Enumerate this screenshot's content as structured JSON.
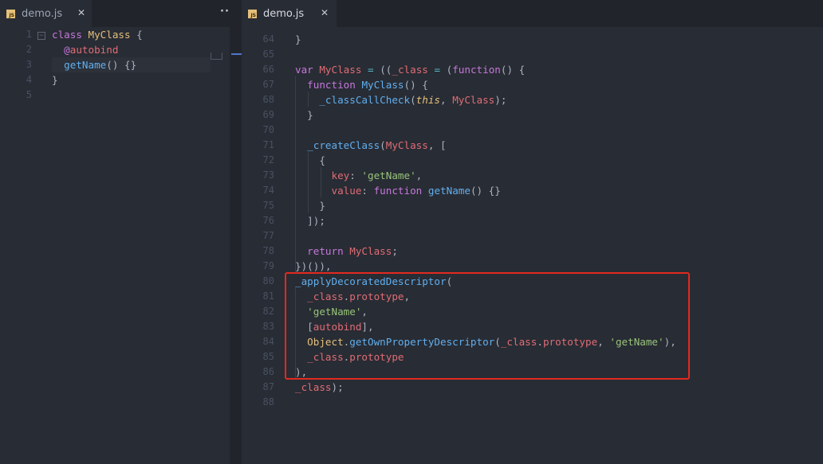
{
  "left_pane": {
    "tab": {
      "badge": "JS",
      "filename": "demo.js",
      "close": "✕"
    },
    "more": "···",
    "lines": [
      {
        "n": "1",
        "tokens": [
          [
            "k",
            "class"
          ],
          [
            "d",
            " "
          ],
          [
            "c",
            "MyClass"
          ],
          [
            "d",
            " {"
          ]
        ]
      },
      {
        "n": "2",
        "tokens": [
          [
            "d",
            "  "
          ],
          [
            "k",
            "@"
          ],
          [
            "v",
            "autobind"
          ]
        ]
      },
      {
        "n": "3",
        "tokens": [
          [
            "d",
            "  "
          ],
          [
            "f",
            "getName"
          ],
          [
            "d",
            "() {}"
          ]
        ]
      },
      {
        "n": "4",
        "tokens": [
          [
            "d",
            "}"
          ]
        ]
      },
      {
        "n": "5",
        "tokens": []
      }
    ]
  },
  "right_pane": {
    "tab": {
      "badge": "JS",
      "filename": "demo.js",
      "close": "✕"
    },
    "lines": [
      {
        "n": "64",
        "tokens": [
          [
            "d",
            "}"
          ]
        ]
      },
      {
        "n": "65",
        "tokens": []
      },
      {
        "n": "66",
        "tokens": [
          [
            "k",
            "var"
          ],
          [
            "d",
            " "
          ],
          [
            "v",
            "MyClass"
          ],
          [
            "d",
            " "
          ],
          [
            "o",
            "="
          ],
          [
            "d",
            " (("
          ],
          [
            "v",
            "_class"
          ],
          [
            "d",
            " "
          ],
          [
            "o",
            "="
          ],
          [
            "d",
            " ("
          ],
          [
            "k",
            "function"
          ],
          [
            "d",
            "() {"
          ]
        ]
      },
      {
        "n": "67",
        "tokens": [
          [
            "d",
            "  "
          ],
          [
            "k",
            "function"
          ],
          [
            "d",
            " "
          ],
          [
            "f",
            "MyClass"
          ],
          [
            "d",
            "() {"
          ]
        ]
      },
      {
        "n": "68",
        "tokens": [
          [
            "d",
            "    "
          ],
          [
            "f",
            "_classCallCheck"
          ],
          [
            "d",
            "("
          ],
          [
            "t",
            "this"
          ],
          [
            "d",
            ", "
          ],
          [
            "v",
            "MyClass"
          ],
          [
            "d",
            ");"
          ]
        ]
      },
      {
        "n": "69",
        "tokens": [
          [
            "d",
            "  }"
          ]
        ]
      },
      {
        "n": "70",
        "tokens": []
      },
      {
        "n": "71",
        "tokens": [
          [
            "d",
            "  "
          ],
          [
            "f",
            "_createClass"
          ],
          [
            "d",
            "("
          ],
          [
            "v",
            "MyClass"
          ],
          [
            "d",
            ", ["
          ]
        ]
      },
      {
        "n": "72",
        "tokens": [
          [
            "d",
            "    {"
          ]
        ]
      },
      {
        "n": "73",
        "tokens": [
          [
            "d",
            "      "
          ],
          [
            "v",
            "key"
          ],
          [
            "d",
            ": "
          ],
          [
            "s",
            "'getName'"
          ],
          [
            "d",
            ","
          ]
        ]
      },
      {
        "n": "74",
        "tokens": [
          [
            "d",
            "      "
          ],
          [
            "v",
            "value"
          ],
          [
            "d",
            ": "
          ],
          [
            "k",
            "function"
          ],
          [
            "d",
            " "
          ],
          [
            "f",
            "getName"
          ],
          [
            "d",
            "() {}"
          ]
        ]
      },
      {
        "n": "75",
        "tokens": [
          [
            "d",
            "    }"
          ]
        ]
      },
      {
        "n": "76",
        "tokens": [
          [
            "d",
            "  ]);"
          ]
        ]
      },
      {
        "n": "77",
        "tokens": []
      },
      {
        "n": "78",
        "tokens": [
          [
            "d",
            "  "
          ],
          [
            "k",
            "return"
          ],
          [
            "d",
            " "
          ],
          [
            "v",
            "MyClass"
          ],
          [
            "d",
            ";"
          ]
        ]
      },
      {
        "n": "79",
        "tokens": [
          [
            "d",
            "})()),"
          ]
        ]
      },
      {
        "n": "80",
        "tokens": [
          [
            "f",
            "_applyDecoratedDescriptor"
          ],
          [
            "d",
            "("
          ]
        ]
      },
      {
        "n": "81",
        "tokens": [
          [
            "d",
            "  "
          ],
          [
            "v",
            "_class"
          ],
          [
            "d",
            "."
          ],
          [
            "v",
            "prototype"
          ],
          [
            "d",
            ","
          ]
        ]
      },
      {
        "n": "82",
        "tokens": [
          [
            "d",
            "  "
          ],
          [
            "s",
            "'getName'"
          ],
          [
            "d",
            ","
          ]
        ]
      },
      {
        "n": "83",
        "tokens": [
          [
            "d",
            "  ["
          ],
          [
            "v",
            "autobind"
          ],
          [
            "d",
            "],"
          ]
        ]
      },
      {
        "n": "84",
        "tokens": [
          [
            "d",
            "  "
          ],
          [
            "c",
            "Object"
          ],
          [
            "d",
            "."
          ],
          [
            "f",
            "getOwnPropertyDescriptor"
          ],
          [
            "d",
            "("
          ],
          [
            "v",
            "_class"
          ],
          [
            "d",
            "."
          ],
          [
            "v",
            "prototype"
          ],
          [
            "d",
            ", "
          ],
          [
            "s",
            "'getName'"
          ],
          [
            "d",
            "),"
          ]
        ]
      },
      {
        "n": "85",
        "tokens": [
          [
            "d",
            "  "
          ],
          [
            "v",
            "_class"
          ],
          [
            "d",
            "."
          ],
          [
            "v",
            "prototype"
          ]
        ]
      },
      {
        "n": "86",
        "tokens": [
          [
            "d",
            "),"
          ]
        ]
      },
      {
        "n": "87",
        "tokens": [
          [
            "v",
            "_class"
          ],
          [
            "d",
            ");"
          ]
        ]
      },
      {
        "n": "88",
        "tokens": []
      }
    ]
  },
  "colors": {
    "editor_bg": "#282c34",
    "tab_bar_bg": "#21252b",
    "highlight_box": "#e32a1f",
    "keyword": "#c678dd",
    "function": "#61afef",
    "variable": "#e06c75",
    "string": "#98c379",
    "class": "#e5c07b"
  }
}
